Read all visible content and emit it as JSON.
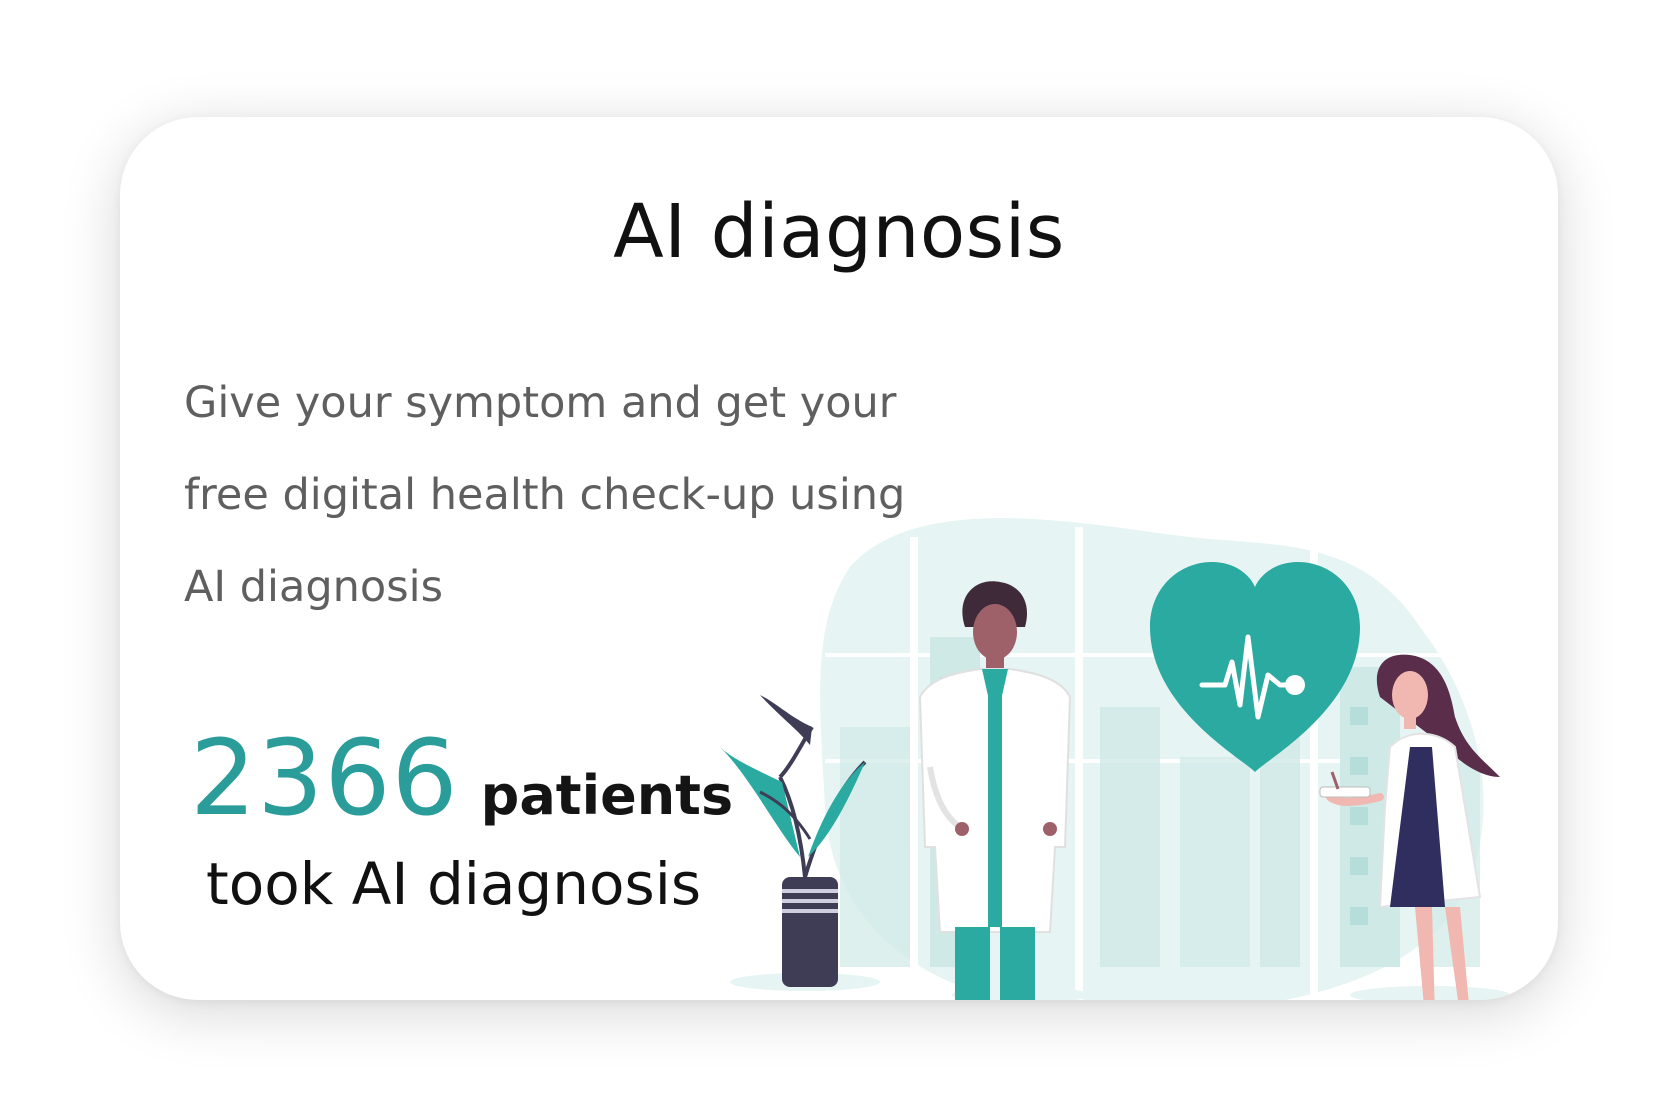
{
  "card": {
    "title": "AI diagnosis",
    "description_lines": [
      "Give your symptom and get your",
      "free digital health check-up using",
      "AI diagnosis"
    ]
  },
  "stats": {
    "patient_count": "2366",
    "patient_unit": "patients",
    "caption": "took AI diagnosis"
  },
  "illustration": {
    "icons": [
      "heart-pulse-icon",
      "doctor-male-figure",
      "doctor-female-figure",
      "potted-plant"
    ],
    "colors": {
      "accent": "#2aaaa0",
      "accent_light": "#d9f0ef",
      "stat_number": "#2a9d9a",
      "pot": "#3f3d56",
      "skin": "#9e616a",
      "scrubs": "#2aaaa0",
      "hair": "#3f2a3a",
      "dress": "#2f2e5e"
    }
  }
}
